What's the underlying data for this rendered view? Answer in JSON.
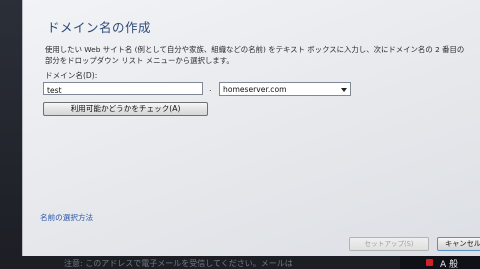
{
  "dialog": {
    "title": "ドメイン名の作成",
    "description": "使用したい Web サイト名 (例として自分や家族、組織などの名前) をテキスト ボックスに入力し、次にドメイン名の 2 番目の部分をドロップダウン リスト メニューから選択します。",
    "domain_label": "ドメイン名(D):",
    "domain_input_value": "test",
    "separator": ".",
    "suffix_selected": "homeserver.com",
    "check_button_label": "利用可能かどうかをチェック(A)",
    "help_link": "名前の選択方法",
    "setup_button_label": "セットアップ(S)",
    "cancel_button_label": "キャンセル"
  },
  "background": {
    "partial_text": "注意: このアドレスで電子メールを受信してください。メールは"
  },
  "taskbar": {
    "ime_indicator": "A 般"
  },
  "colors": {
    "title": "#2c4a78",
    "link": "#2a56a8",
    "error_icon": "#d4202b"
  }
}
